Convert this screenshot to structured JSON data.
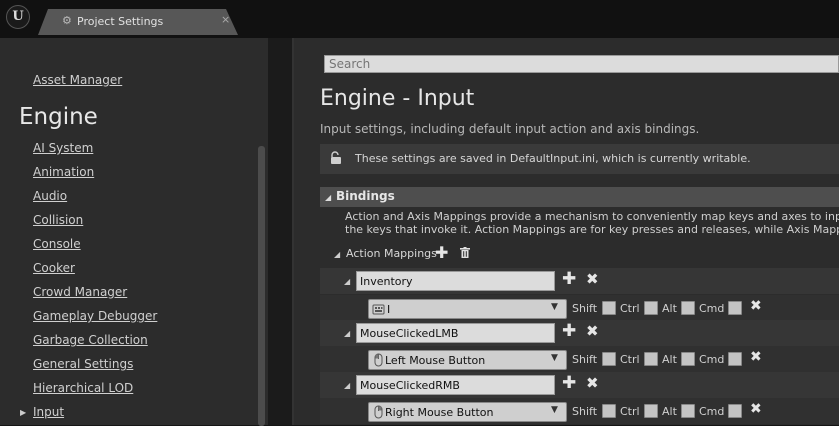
{
  "window": {
    "logo": "U",
    "tab_icon": "gear-icon",
    "tab_title": "Project Settings",
    "tab_close": "×"
  },
  "sidebar": {
    "top_item": "Asset Manager",
    "heading": "Engine",
    "items": [
      {
        "label": "AI System"
      },
      {
        "label": "Animation"
      },
      {
        "label": "Audio"
      },
      {
        "label": "Collision"
      },
      {
        "label": "Console"
      },
      {
        "label": "Cooker"
      },
      {
        "label": "Crowd Manager"
      },
      {
        "label": "Gameplay Debugger"
      },
      {
        "label": "Garbage Collection"
      },
      {
        "label": "General Settings"
      },
      {
        "label": "Hierarchical LOD"
      },
      {
        "label": "Input",
        "selected": true
      }
    ]
  },
  "main": {
    "search_placeholder": "Search",
    "title": "Engine - Input",
    "subtitle": "Input settings, including default input action and axis bindings.",
    "notice": "These settings are saved in DefaultInput.ini, which is currently writable.",
    "bindings": {
      "label": "Bindings",
      "desc_line1": "Action and Axis Mappings provide a mechanism to conveniently map keys and axes to input be",
      "desc_line2": "the keys that invoke it. Action Mappings are for key presses and releases, while Axis Mappings",
      "action_mappings_label": "Action Mappings",
      "add_icon": "plus-icon",
      "delete_icon": "trash-icon",
      "mappings": [
        {
          "name": "Inventory",
          "key": "I",
          "key_icon": "keyboard-icon",
          "modifiers": {
            "shift": "Shift",
            "ctrl": "Ctrl",
            "alt": "Alt",
            "cmd": "Cmd"
          },
          "shift": false,
          "ctrl": false,
          "alt": false,
          "cmd": false
        },
        {
          "name": "MouseClickedLMB",
          "key": "Left Mouse Button",
          "key_icon": "mouse-icon",
          "modifiers": {
            "shift": "Shift",
            "ctrl": "Ctrl",
            "alt": "Alt",
            "cmd": "Cmd"
          },
          "shift": false,
          "ctrl": false,
          "alt": false,
          "cmd": false
        },
        {
          "name": "MouseClickedRMB",
          "key": "Right Mouse Button",
          "key_icon": "mouse-icon",
          "modifiers": {
            "shift": "Shift",
            "ctrl": "Ctrl",
            "alt": "Alt",
            "cmd": "Cmd"
          },
          "shift": false,
          "ctrl": false,
          "alt": false,
          "cmd": false
        }
      ]
    }
  }
}
